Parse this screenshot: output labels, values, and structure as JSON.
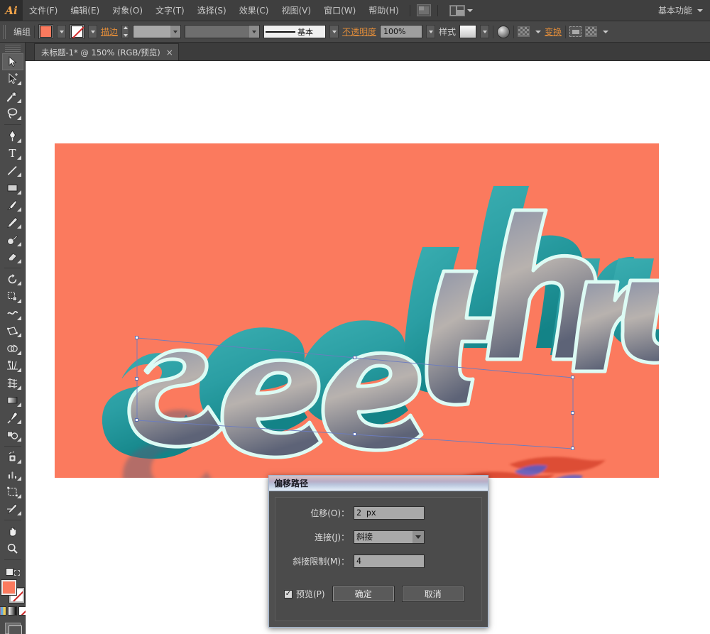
{
  "app": {
    "logo": "Ai",
    "workspace": "基本功能"
  },
  "menubar": {
    "items": [
      {
        "label": "文件(F)"
      },
      {
        "label": "编辑(E)"
      },
      {
        "label": "对象(O)"
      },
      {
        "label": "文字(T)"
      },
      {
        "label": "选择(S)"
      },
      {
        "label": "效果(C)"
      },
      {
        "label": "视图(V)"
      },
      {
        "label": "窗口(W)"
      },
      {
        "label": "帮助(H)"
      }
    ],
    "bridge_icon": "bridge-icon",
    "arrange_icon": "arrange-documents-icon"
  },
  "optionsbar": {
    "selection_label": "编组",
    "fill_color": "#fb7a5e",
    "stroke_label": "描边",
    "stroke_value": "",
    "stroke_profile": "",
    "brush_label": "基本",
    "opacity_label": "不透明度",
    "opacity_value": "100%",
    "style_label": "样式",
    "transform_label": "变换",
    "icons": [
      "fill-swatch-icon",
      "stroke-swatch-icon",
      "stroke-weight-stepper-icon",
      "brush-definition-icon",
      "opacity-icon",
      "graphic-style-icon",
      "recolor-artwork-icon",
      "align-icon",
      "transform-icon",
      "isolate-icon",
      "shape-builder-icon"
    ]
  },
  "document_tab": {
    "title": "未标题-1* @ 150% (RGB/预览)",
    "close": "×"
  },
  "toolbar": {
    "tools": [
      {
        "name": "selection-tool",
        "selected": true
      },
      {
        "name": "direct-selection-tool",
        "selected": false
      },
      {
        "name": "magic-wand-tool",
        "selected": false
      },
      {
        "name": "lasso-tool",
        "selected": false
      },
      {
        "name": "pen-tool",
        "selected": false
      },
      {
        "name": "type-tool",
        "selected": false
      },
      {
        "name": "line-segment-tool",
        "selected": false
      },
      {
        "name": "rectangle-tool",
        "selected": false
      },
      {
        "name": "paintbrush-tool",
        "selected": false
      },
      {
        "name": "pencil-tool",
        "selected": false
      },
      {
        "name": "blob-brush-tool",
        "selected": false
      },
      {
        "name": "eraser-tool",
        "selected": false
      },
      {
        "name": "rotate-tool",
        "selected": false
      },
      {
        "name": "scale-tool",
        "selected": false
      },
      {
        "name": "width-tool",
        "selected": false
      },
      {
        "name": "free-transform-tool",
        "selected": false
      },
      {
        "name": "shape-builder-tool",
        "selected": false
      },
      {
        "name": "perspective-grid-tool",
        "selected": false
      },
      {
        "name": "mesh-tool",
        "selected": false
      },
      {
        "name": "gradient-tool",
        "selected": false
      },
      {
        "name": "eyedropper-tool",
        "selected": false
      },
      {
        "name": "blend-tool",
        "selected": false
      },
      {
        "name": "symbol-sprayer-tool",
        "selected": false
      },
      {
        "name": "column-graph-tool",
        "selected": false
      },
      {
        "name": "artboard-tool",
        "selected": false
      },
      {
        "name": "slice-tool",
        "selected": false
      },
      {
        "name": "hand-tool",
        "selected": false
      },
      {
        "name": "zoom-tool",
        "selected": false
      }
    ],
    "fill_color": "#fb7a5e",
    "stroke_color": "none"
  },
  "canvas": {
    "artboard_color": "#fb7a5e",
    "artwork_text": "see thru",
    "artwork_fill_top": "#2ba8ae",
    "artwork_fill_deep": "#0d8e92",
    "artwork_outline": "#d9f7f2",
    "artwork_shadow": "#6e6f84",
    "offset_preview_blue": "#4a5fd4",
    "offset_preview_red": "#e03a2a",
    "selection_color": "#6b7cc0"
  },
  "dialog": {
    "title": "偏移路径",
    "rows": [
      {
        "label": "位移(O)：",
        "value": "2 px",
        "type": "input"
      },
      {
        "label": "连接(J)：",
        "value": "斜接",
        "type": "select"
      },
      {
        "label": "斜接限制(M)：",
        "value": "4",
        "type": "input"
      }
    ],
    "preview_label": "预览(P)",
    "preview_checked": true,
    "check_glyph": "✓",
    "ok_label": "确定",
    "cancel_label": "取消"
  }
}
